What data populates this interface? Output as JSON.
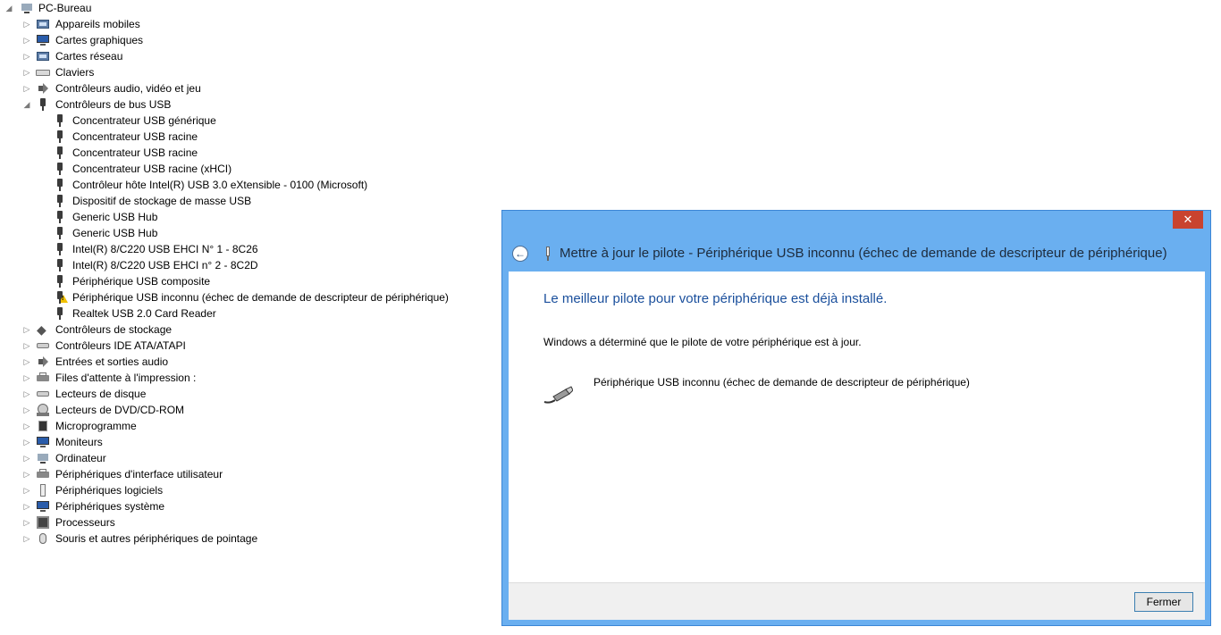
{
  "tree": [
    {
      "label": "PC-Bureau",
      "level": 0,
      "expanded": true,
      "icon": "computer-icon",
      "warning": false
    },
    {
      "label": "Appareils mobiles",
      "level": 1,
      "expanded": false,
      "icon": "mobile-device-icon",
      "warning": false
    },
    {
      "label": "Cartes graphiques",
      "level": 1,
      "expanded": false,
      "icon": "display-adapter-icon",
      "warning": false
    },
    {
      "label": "Cartes réseau",
      "level": 1,
      "expanded": false,
      "icon": "network-adapter-icon",
      "warning": false
    },
    {
      "label": "Claviers",
      "level": 1,
      "expanded": false,
      "icon": "keyboard-icon",
      "warning": false
    },
    {
      "label": "Contrôleurs audio, vidéo et jeu",
      "level": 1,
      "expanded": false,
      "icon": "speaker-icon",
      "warning": false
    },
    {
      "label": "Contrôleurs de bus USB",
      "level": 1,
      "expanded": true,
      "icon": "usb-plug-icon",
      "warning": false
    },
    {
      "label": "Concentrateur USB générique",
      "level": 2,
      "icon": "usb-plug-icon",
      "warning": false
    },
    {
      "label": "Concentrateur USB racine",
      "level": 2,
      "icon": "usb-plug-icon",
      "warning": false
    },
    {
      "label": "Concentrateur USB racine",
      "level": 2,
      "icon": "usb-plug-icon",
      "warning": false
    },
    {
      "label": "Concentrateur USB racine (xHCI)",
      "level": 2,
      "icon": "usb-plug-icon",
      "warning": false
    },
    {
      "label": "Contrôleur hôte Intel(R) USB 3.0 eXtensible - 0100 (Microsoft)",
      "level": 2,
      "icon": "usb-plug-icon",
      "warning": false
    },
    {
      "label": "Dispositif de stockage de masse USB",
      "level": 2,
      "icon": "usb-plug-icon",
      "warning": false
    },
    {
      "label": "Generic USB Hub",
      "level": 2,
      "icon": "usb-plug-icon",
      "warning": false
    },
    {
      "label": "Generic USB Hub",
      "level": 2,
      "icon": "usb-plug-icon",
      "warning": false
    },
    {
      "label": "Intel(R) 8/C220 USB EHCI N° 1 - 8C26",
      "level": 2,
      "icon": "usb-plug-icon",
      "warning": false
    },
    {
      "label": "Intel(R) 8/C220 USB EHCI n° 2 - 8C2D",
      "level": 2,
      "icon": "usb-plug-icon",
      "warning": false
    },
    {
      "label": "Périphérique USB composite",
      "level": 2,
      "icon": "usb-plug-icon",
      "warning": false
    },
    {
      "label": "Périphérique USB inconnu (échec de demande de descripteur de périphérique)",
      "level": 2,
      "icon": "usb-plug-icon",
      "warning": true
    },
    {
      "label": "Realtek USB 2.0 Card Reader",
      "level": 2,
      "icon": "usb-plug-icon",
      "warning": false
    },
    {
      "label": "Contrôleurs de stockage",
      "level": 1,
      "expanded": false,
      "icon": "storage-controller-icon",
      "warning": false
    },
    {
      "label": "Contrôleurs IDE ATA/ATAPI",
      "level": 1,
      "expanded": false,
      "icon": "ide-controller-icon",
      "warning": false
    },
    {
      "label": "Entrées et sorties audio",
      "level": 1,
      "expanded": false,
      "icon": "speaker-icon",
      "warning": false
    },
    {
      "label": "Files d'attente à l'impression :",
      "level": 1,
      "expanded": false,
      "icon": "printer-icon",
      "warning": false
    },
    {
      "label": "Lecteurs de disque",
      "level": 1,
      "expanded": false,
      "icon": "disk-drive-icon",
      "warning": false
    },
    {
      "label": "Lecteurs de DVD/CD-ROM",
      "level": 1,
      "expanded": false,
      "icon": "dvd-drive-icon",
      "warning": false
    },
    {
      "label": "Microprogramme",
      "level": 1,
      "expanded": false,
      "icon": "firmware-chip-icon",
      "warning": false
    },
    {
      "label": "Moniteurs",
      "level": 1,
      "expanded": false,
      "icon": "monitor-icon",
      "warning": false
    },
    {
      "label": "Ordinateur",
      "level": 1,
      "expanded": false,
      "icon": "computer-icon",
      "warning": false
    },
    {
      "label": "Périphériques d'interface utilisateur",
      "level": 1,
      "expanded": false,
      "icon": "hid-icon",
      "warning": false
    },
    {
      "label": "Périphériques logiciels",
      "level": 1,
      "expanded": false,
      "icon": "software-device-icon",
      "warning": false
    },
    {
      "label": "Périphériques système",
      "level": 1,
      "expanded": false,
      "icon": "system-device-icon",
      "warning": false
    },
    {
      "label": "Processeurs",
      "level": 1,
      "expanded": false,
      "icon": "processor-icon",
      "warning": false
    },
    {
      "label": "Souris et autres périphériques de pointage",
      "level": 1,
      "expanded": false,
      "icon": "mouse-icon",
      "warning": false
    }
  ],
  "dialog": {
    "close_glyph": "✕",
    "back_glyph": "←",
    "title": "Mettre à jour le pilote - Périphérique USB inconnu (échec de demande de descripteur de périphérique)",
    "headline": "Le meilleur pilote pour votre périphérique est déjà installé.",
    "description": "Windows a déterminé que le pilote de votre périphérique est à jour.",
    "device_name": "Périphérique USB inconnu (échec de demande de descripteur de périphérique)",
    "close_button_label": "Fermer",
    "accent_color": "#6aaff0",
    "headline_color": "#1a4f9c",
    "close_button_color": "#c9432f"
  }
}
